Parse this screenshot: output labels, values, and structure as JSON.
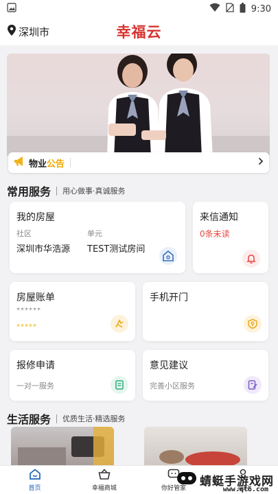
{
  "status_bar": {
    "time": "9:30"
  },
  "header": {
    "location": "深圳市",
    "brand": "幸福云"
  },
  "notice": {
    "label_a": "物业",
    "label_b": "公告"
  },
  "services_section": {
    "title": "常用服务",
    "subtitle": "用心做事·真诚服务"
  },
  "my_house": {
    "title": "我的房屋",
    "community_label": "社区",
    "community_value": "深圳市华浩源",
    "unit_label": "单元",
    "unit_value": "TEST测试房间"
  },
  "messages": {
    "title": "来信通知",
    "count_text": "0条未读"
  },
  "bill": {
    "title": "房屋账单",
    "masked_1": "******",
    "masked_2": "*****"
  },
  "door": {
    "title": "手机开门"
  },
  "repair": {
    "title": "报修申请",
    "subtitle": "一对一服务"
  },
  "feedback": {
    "title": "意见建议",
    "subtitle": "完善小区服务"
  },
  "life_section": {
    "title": "生活服务",
    "subtitle": "优质生活·精选服务"
  },
  "tabbar": {
    "items": [
      {
        "label": "首页",
        "active": true
      },
      {
        "label": "幸福商城",
        "active": false
      },
      {
        "label": "你好管家",
        "active": false
      },
      {
        "label": "我的",
        "active": false
      }
    ]
  },
  "watermark": {
    "text": "蜻蜓手游戏网",
    "url": "www.qt6.com"
  },
  "colors": {
    "brand_red": "#d8322e",
    "accent_yellow": "#f0a800",
    "unread_red": "#e8473f",
    "tab_active_blue": "#1b63b8"
  }
}
